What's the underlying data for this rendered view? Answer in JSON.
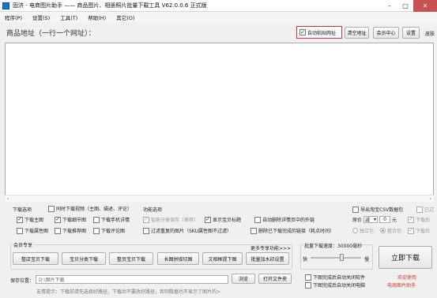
{
  "window": {
    "title": "固济 - 电商图片助手 —— 商品图片、相册照片批量下载工具 V62.0.0.6 正式版",
    "min_glyph": "–",
    "max_glyph": "□",
    "close_glyph": "✕"
  },
  "menu": {
    "items": [
      "程序(P)",
      "设置(S)",
      "工具(T)",
      "帮助(H)",
      "其它(O)"
    ]
  },
  "header": {
    "label": "商品地址（一行一个网址）：",
    "auto_paste": "自动粘贴网址",
    "clear_btn": "清空地址",
    "member_btn": "会员中心",
    "settings_btn": "设置",
    "skin_label": "皮肤"
  },
  "url_area": {
    "value": "",
    "left_arrow": "‹",
    "right_arrow": "›"
  },
  "download_options": {
    "title": "下载选项",
    "sync_label": "同时下载视频（主图、描述、评论）",
    "items": [
      {
        "label": "下载主图",
        "checked": true
      },
      {
        "label": "下载细节图",
        "checked": true
      },
      {
        "label": "下载手机详情",
        "checked": false
      },
      {
        "label": "下载属性图",
        "checked": false
      },
      {
        "label": "下载推荐图",
        "checked": false
      },
      {
        "label": "下载评论图",
        "checked": false
      }
    ]
  },
  "function_options": {
    "title": "功能选项",
    "items": [
      {
        "label": "智能分类保存（推荐）",
        "checked": true,
        "disabled": true
      },
      {
        "label": "显示宝贝标题",
        "checked": true,
        "disabled": false
      },
      {
        "label": "自动删除详情页中的外链",
        "checked": false,
        "disabled": false
      },
      {
        "label": "过滤重复的图片（SKU属性图不过滤）",
        "checked": false,
        "disabled": false
      },
      {
        "label": "删除已下载完成的链接（耗点时间）",
        "checked": false,
        "disabled": false
      }
    ]
  },
  "export": {
    "csv_label": "导出淘宝CSV数据包",
    "csv_extra": "已过",
    "price_label": "原价",
    "price_op": "减",
    "price_value": "0",
    "unit": "元",
    "download_also": "下载后",
    "independent": "独立包",
    "merge": "整合包",
    "download_after": "下载后"
  },
  "member_zone": {
    "title": "会员专享",
    "more": "更多专享功能>>>",
    "buttons": [
      "整店宝贝下载",
      "宝贝分类下载",
      "整页宝贝下载",
      "长图拼接切图",
      "文相框提下图",
      "批量加水印设置"
    ]
  },
  "speed": {
    "title": "批量下载速度：30000毫秒",
    "low": "快",
    "high": "慢",
    "level": 0.62
  },
  "bottom": {
    "save_label": "保存位置：",
    "save_path": "D:\\图片下载",
    "browse_btn": "浏览",
    "open_folder_btn": "打开文件夹",
    "tip": "友情提示：下载前请先选择好路径，下载后不要改好路径，否则数据也不显示了图片的>",
    "auto_close": "下图完成后自动关闭软件",
    "auto_shutdown": "下图完成后自动关闭电脑"
  },
  "start": {
    "button": "立即下载",
    "promo1": "欢迎使用",
    "promo2": "电商图片助手"
  }
}
